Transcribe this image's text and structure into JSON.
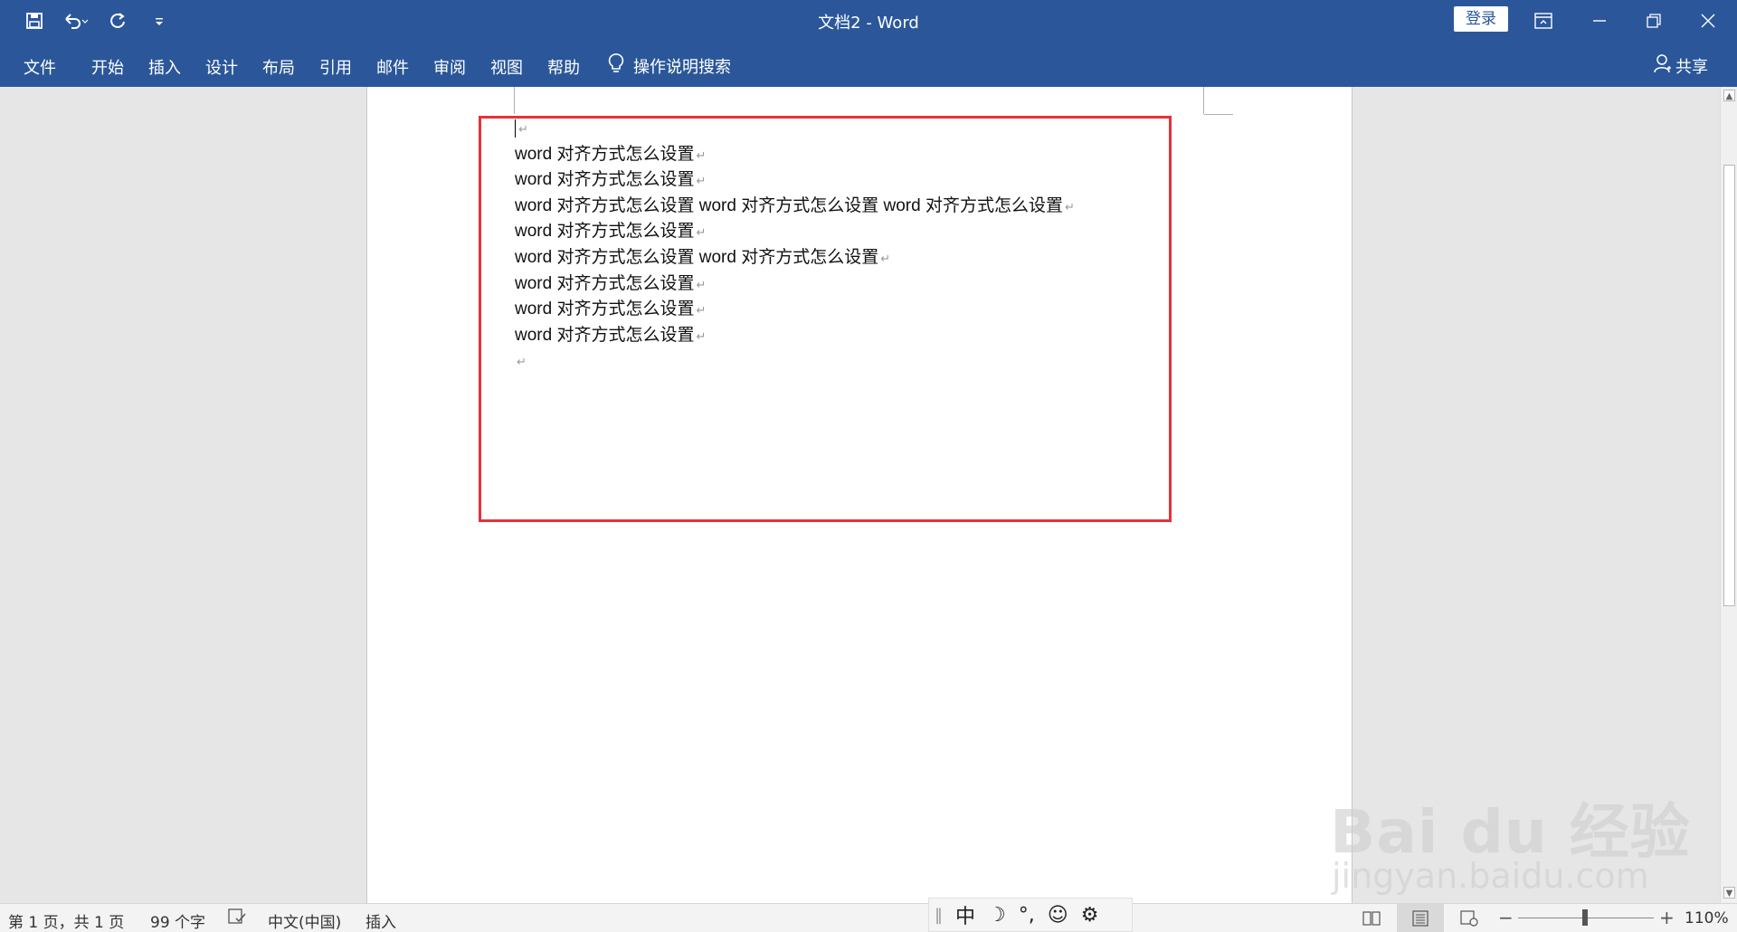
{
  "window": {
    "title": "文档2  -  Word",
    "login_label": "登录"
  },
  "qat": {
    "save_icon": "save-icon",
    "undo_icon": "undo-icon",
    "redo_icon": "redo-icon",
    "customize_icon": "customize-qat-icon"
  },
  "ribbon": {
    "tabs": [
      "文件",
      "开始",
      "插入",
      "设计",
      "布局",
      "引用",
      "邮件",
      "审阅",
      "视图",
      "帮助"
    ],
    "search_label": "操作说明搜索",
    "share_label": "共享"
  },
  "document": {
    "lines": [
      "",
      "word 对齐方式怎么设置",
      "word 对齐方式怎么设置",
      "word 对齐方式怎么设置 word 对齐方式怎么设置 word 对齐方式怎么设置",
      "word 对齐方式怎么设置",
      "word 对齐方式怎么设置 word 对齐方式怎么设置",
      "word 对齐方式怎么设置",
      "word 对齐方式怎么设置",
      "word 对齐方式怎么设置",
      ""
    ],
    "paragraph_mark": "↵",
    "highlight_color": "#e5323a"
  },
  "status": {
    "page_info": "第 1 页，共 1 页",
    "word_count": "99 个字",
    "language": "中文(中国)",
    "insert_mode": "插入",
    "zoom": "110%"
  },
  "ime": {
    "mode": "中",
    "moon": "☽",
    "punct": "°,",
    "emoji": "☺",
    "settings": "⚙"
  },
  "watermark": {
    "brand": "Bai du 经验",
    "url": "jingyan.baidu.com"
  },
  "colors": {
    "titlebar": "#2b579a"
  }
}
